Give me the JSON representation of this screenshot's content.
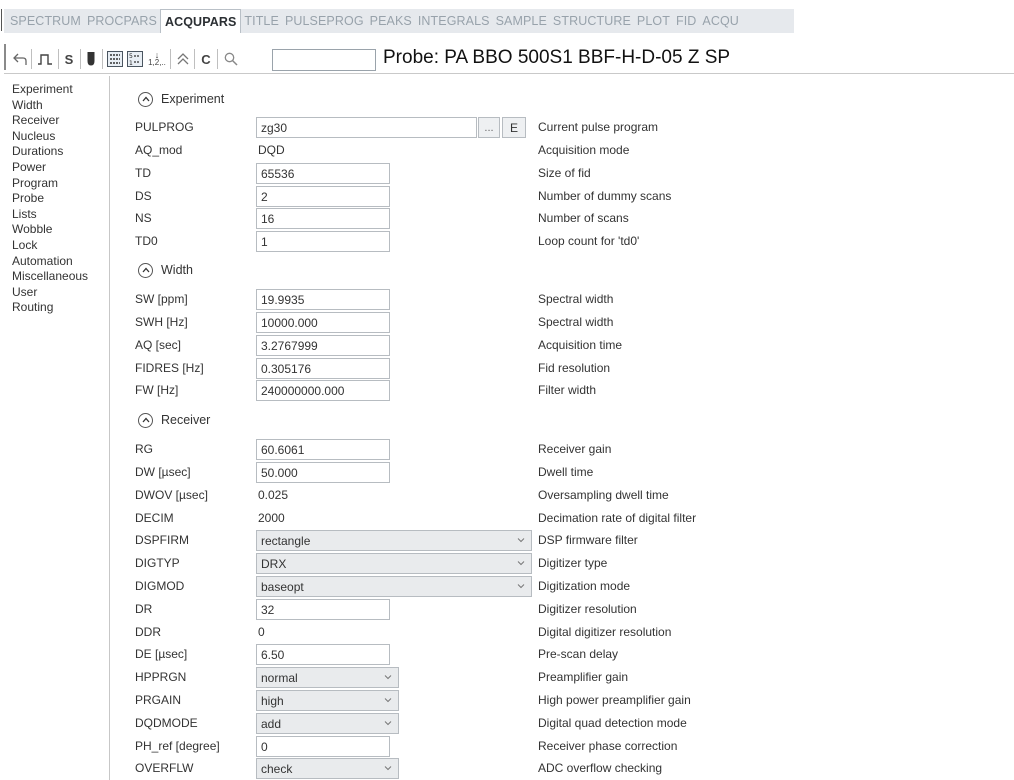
{
  "tabs": [
    "SPECTRUM",
    "PROCPARS",
    "ACQUPARS",
    "TITLE",
    "PULSEPROG",
    "PEAKS",
    "INTEGRALS",
    "SAMPLE",
    "STRUCTURE",
    "PLOT",
    "FID",
    "ACQU"
  ],
  "active_tab": "ACQUPARS",
  "toolbar": {
    "s_label": "S",
    "c_label": "C",
    "sort_label": "1,2,..",
    "search_value": "",
    "probe": "Probe: PA BBO 500S1 BBF-H-D-05 Z SP",
    "icons": [
      "back-arrow-icon",
      "pulse-icon",
      "s-icon",
      "probe-icon",
      "grid-icon",
      "grid-number-icon",
      "sort-icon",
      "collapse-all-icon",
      "c-icon",
      "search-icon"
    ]
  },
  "sidebar": {
    "items": [
      "Experiment",
      "Width",
      "Receiver",
      "Nucleus",
      "Durations",
      "Power",
      "Program",
      "Probe",
      "Lists",
      "Wobble",
      "Lock",
      "Automation",
      "Miscellaneous",
      "User",
      "Routing"
    ]
  },
  "sections": {
    "experiment": {
      "title": "Experiment",
      "pulprog": {
        "label": "PULPROG",
        "value": "zg30",
        "dots": "...",
        "edit": "E",
        "desc": "Current pulse program"
      },
      "aq_mod": {
        "label": "AQ_mod",
        "value": "DQD",
        "desc": "Acquisition mode"
      },
      "td": {
        "label": "TD",
        "value": "65536",
        "desc": "Size of fid"
      },
      "ds": {
        "label": "DS",
        "value": "2",
        "desc": "Number of dummy scans"
      },
      "ns": {
        "label": "NS",
        "value": "16",
        "desc": "Number of scans"
      },
      "td0": {
        "label": "TD0",
        "value": "1",
        "desc": "Loop count for 'td0'"
      }
    },
    "width": {
      "title": "Width",
      "sw": {
        "label": "SW [ppm]",
        "value": "19.9935",
        "desc": "Spectral width"
      },
      "swh": {
        "label": "SWH [Hz]",
        "value": "10000.000",
        "desc": "Spectral width"
      },
      "aq": {
        "label": "AQ [sec]",
        "value": "3.2767999",
        "desc": "Acquisition time"
      },
      "fidres": {
        "label": "FIDRES [Hz]",
        "value": "0.305176",
        "desc": "Fid resolution"
      },
      "fw": {
        "label": "FW [Hz]",
        "value": "240000000.000",
        "desc": "Filter width"
      }
    },
    "receiver": {
      "title": "Receiver",
      "rg": {
        "label": "RG",
        "value": "60.6061",
        "desc": "Receiver gain"
      },
      "dw": {
        "label": "DW [µsec]",
        "value": "50.000",
        "desc": "Dwell time"
      },
      "dwov": {
        "label": "DWOV [µsec]",
        "value": "0.025",
        "desc": "Oversampling dwell time"
      },
      "decim": {
        "label": "DECIM",
        "value": "2000",
        "desc": "Decimation rate of digital filter"
      },
      "dspfirm": {
        "label": "DSPFIRM",
        "value": "rectangle",
        "desc": "DSP firmware filter"
      },
      "digtyp": {
        "label": "DIGTYP",
        "value": "DRX",
        "desc": "Digitizer type"
      },
      "digmod": {
        "label": "DIGMOD",
        "value": "baseopt",
        "desc": "Digitization mode"
      },
      "dr": {
        "label": "DR",
        "value": "32",
        "desc": "Digitizer resolution"
      },
      "ddr": {
        "label": "DDR",
        "value": "0",
        "desc": "Digital digitizer resolution"
      },
      "de": {
        "label": "DE [µsec]",
        "value": "6.50",
        "desc": "Pre-scan delay"
      },
      "hpprgn": {
        "label": "HPPRGN",
        "value": "normal",
        "desc": "Preamplifier gain"
      },
      "prgain": {
        "label": "PRGAIN",
        "value": "high",
        "desc": "High power preamplifier gain"
      },
      "dqdmode": {
        "label": "DQDMODE",
        "value": "add",
        "desc": "Digital quad detection mode"
      },
      "ph_ref": {
        "label": "PH_ref [degree]",
        "value": "0",
        "desc": "Receiver phase correction"
      },
      "overflw": {
        "label": "OVERFLW",
        "value": "check",
        "desc": "ADC overflow checking"
      }
    }
  }
}
